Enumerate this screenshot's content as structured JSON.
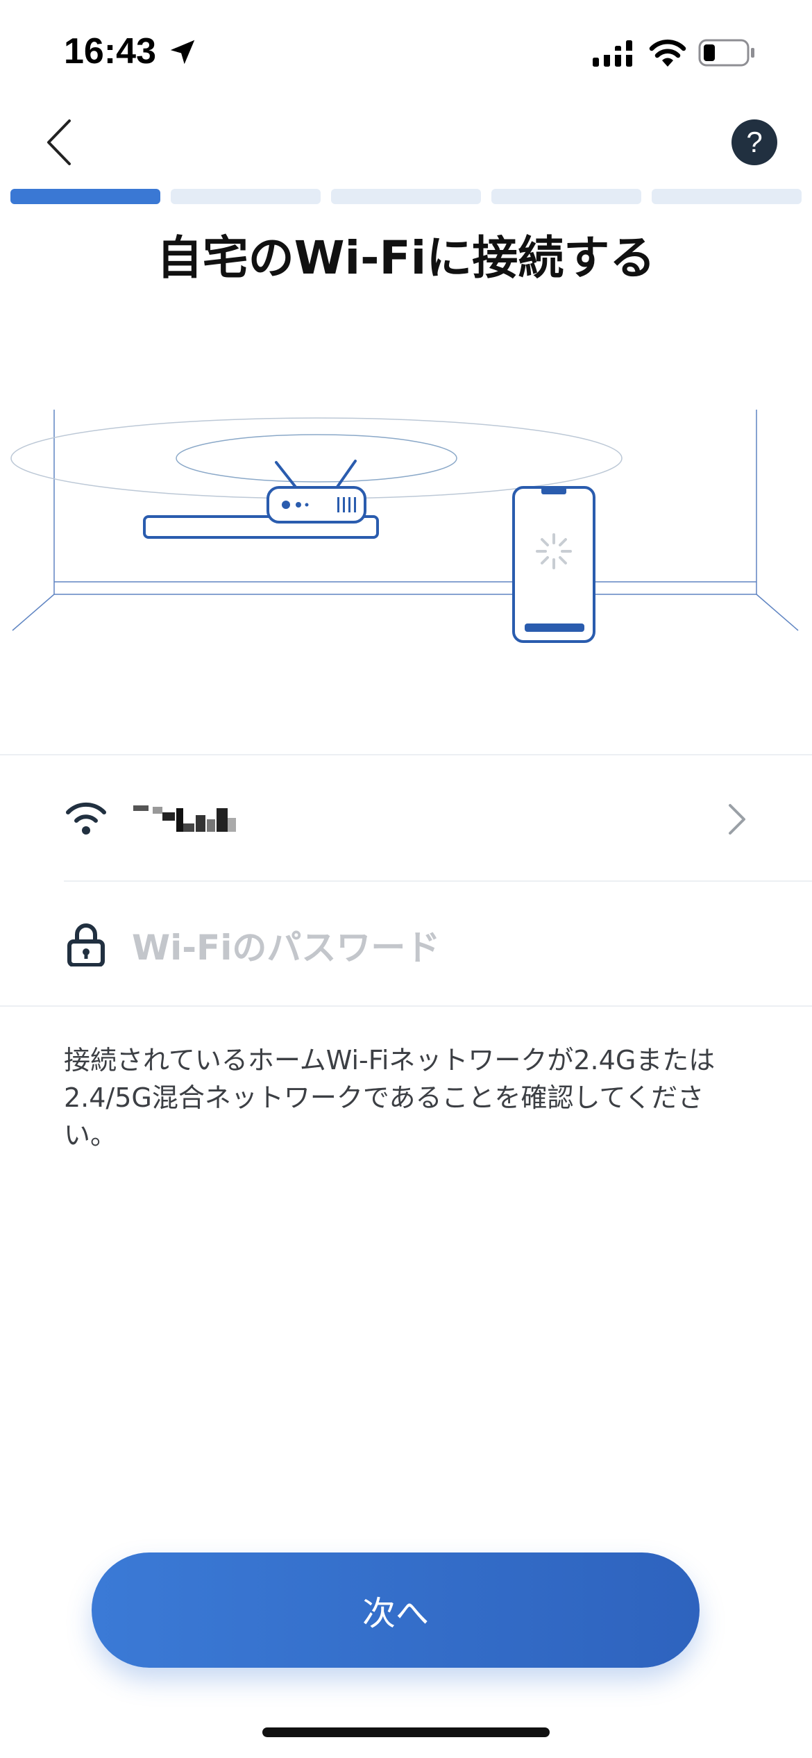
{
  "status_bar": {
    "time": "16:43",
    "icons": [
      "location-arrow-icon",
      "cellular-signal-icon",
      "wifi-icon",
      "battery-icon"
    ]
  },
  "nav": {
    "back_icon": "chevron-left-icon",
    "help_label": "?"
  },
  "progress": {
    "total_steps": 5,
    "current_step": 1
  },
  "title": "自宅のWi-Fiに接続する",
  "network": {
    "icon": "wifi-icon",
    "ssid_note": "SSID obscured (pixelated)",
    "chevron_icon": "chevron-right-icon"
  },
  "password": {
    "icon": "lock-icon",
    "placeholder": "Wi-Fiのパスワード",
    "value": ""
  },
  "info_text": "接続されているホームWi-Fiネットワークが2.4Gまたは2.4/5G混合ネットワークであることを確認してください。",
  "next_button_label": "次へ",
  "colors": {
    "accent": "#3a78d4",
    "progress_inactive": "#e4ecf6",
    "help_bg": "#213040",
    "line_art": "#2a5cae"
  }
}
